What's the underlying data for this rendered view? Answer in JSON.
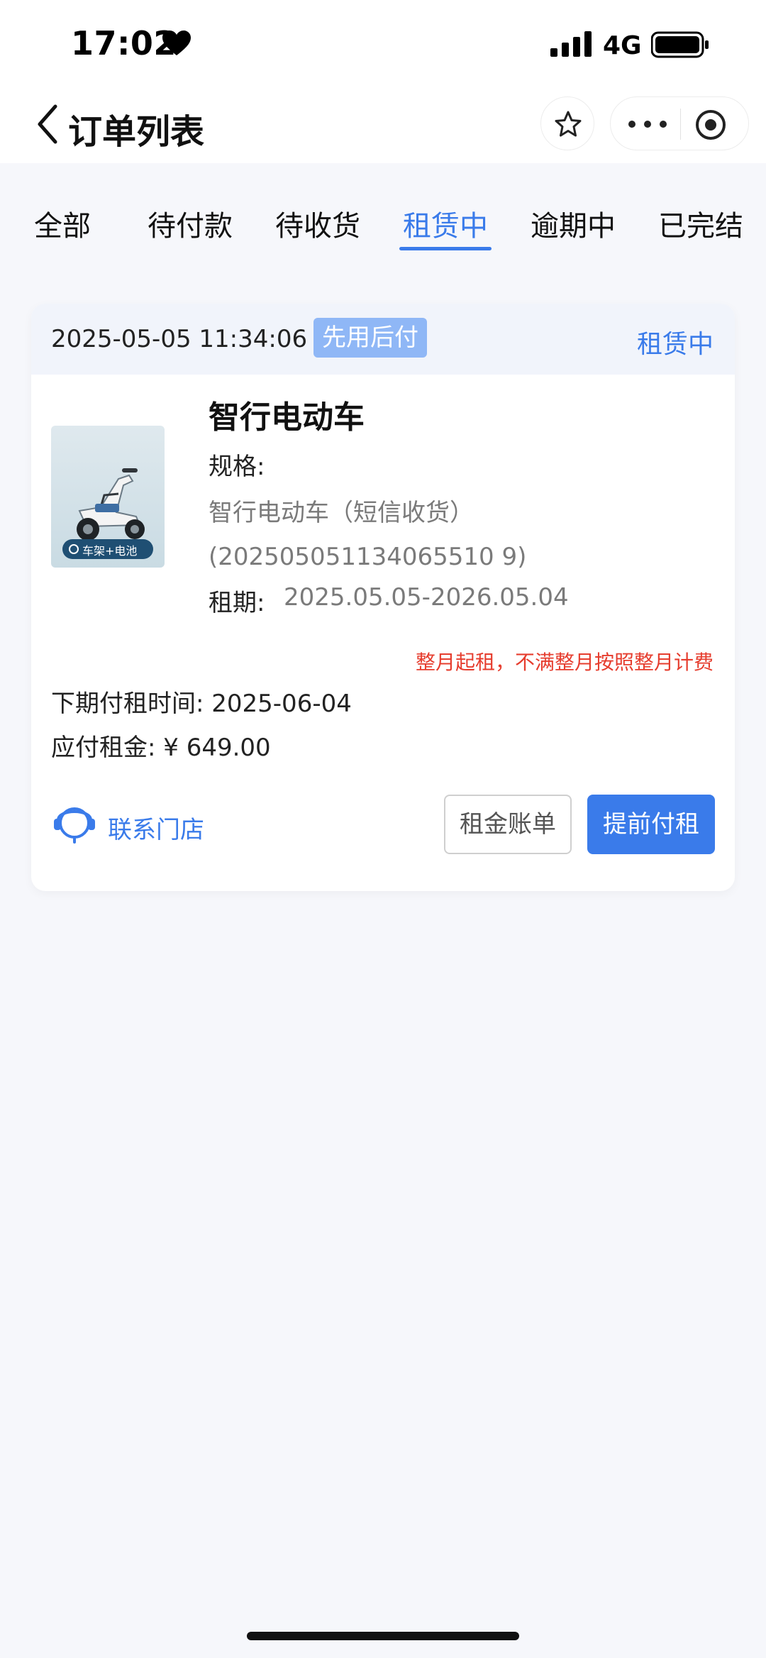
{
  "status_bar": {
    "time": "17:02",
    "network": "4G"
  },
  "nav": {
    "title": "订单列表"
  },
  "tabs": [
    {
      "label": "全部"
    },
    {
      "label": "待付款"
    },
    {
      "label": "待收货"
    },
    {
      "label": "租赁中",
      "active": true
    },
    {
      "label": "逾期中"
    },
    {
      "label": "已完结"
    }
  ],
  "order": {
    "time": "2025-05-05 11:34:06",
    "pay_tag": "先用后付",
    "status": "租赁中",
    "product": {
      "name": "智行电动车",
      "image_caption": "车架+电池",
      "spec_label": "规格:",
      "spec_value": "智行电动车（短信收货）(202505051134065510 9)",
      "term_label": "租期:",
      "term_value": "2025.05.05-2026.05.04"
    },
    "notice": "整月起租，不满整月按照整月计费",
    "next_pay": "下期付租时间: 2025-06-04",
    "amount": "应付租金: ¥ 649.00",
    "contact_label": "联系门店",
    "buttons": {
      "bill": "租金账单",
      "prepay": "提前付租"
    }
  },
  "colors": {
    "accent": "#3a7bea",
    "notice": "#e63d2e",
    "tag": "#8fb7f6"
  }
}
